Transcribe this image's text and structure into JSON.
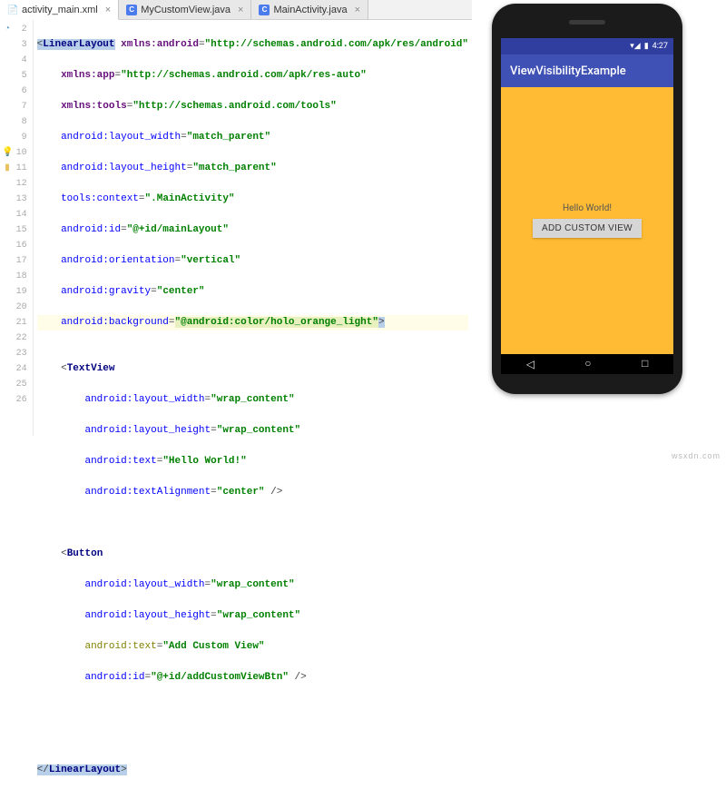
{
  "tabs": [
    {
      "label": "activity_main.xml",
      "kind": "xml",
      "active": true
    },
    {
      "label": "MyCustomView.java",
      "kind": "java",
      "active": false
    },
    {
      "label": "MainActivity.java",
      "kind": "java",
      "active": false
    }
  ],
  "gutter": {
    "lines": [
      "2",
      "3",
      "4",
      "5",
      "6",
      "7",
      "8",
      "9",
      "10",
      "11",
      "12",
      "13",
      "14",
      "15",
      "16",
      "17",
      "18",
      "19",
      "20",
      "21",
      "22",
      "23",
      "24",
      "25",
      "26"
    ],
    "bulb_at": "10",
    "warn_at": "11",
    "circle_at": "2",
    "fold_at": [
      "2",
      "13",
      "19",
      "26"
    ]
  },
  "code": {
    "l2": {
      "open": "<",
      "tag": "LinearLayout",
      "sp": " ",
      "ns": "xmlns:android",
      "eq": "=",
      "val": "\"http://schemas.android.com/apk/res/android\""
    },
    "l3": {
      "ns": "xmlns:app",
      "eq": "=",
      "val": "\"http://schemas.android.com/apk/res-auto\""
    },
    "l4": {
      "ns": "xmlns:tools",
      "eq": "=",
      "val": "\"http://schemas.android.com/tools\""
    },
    "l5": {
      "attr": "android:layout_width",
      "eq": "=",
      "val": "\"match_parent\""
    },
    "l6": {
      "attr": "android:layout_height",
      "eq": "=",
      "val": "\"match_parent\""
    },
    "l7": {
      "attr": "tools:context",
      "eq": "=",
      "val": "\".MainActivity\""
    },
    "l8": {
      "attr": "android:id",
      "eq": "=",
      "val": "\"@+id/mainLayout\""
    },
    "l9": {
      "attr": "android:orientation",
      "eq": "=",
      "val": "\"vertical\""
    },
    "l10": {
      "attr": "android:gravity",
      "eq": "=",
      "val": "\"center\""
    },
    "l11": {
      "attr": "android:background",
      "eq": "=",
      "val": "\"@android:color/holo_orange_light\"",
      "close": ">"
    },
    "l13": {
      "open": "<",
      "tag": "TextView"
    },
    "l14": {
      "attr": "android:layout_width",
      "eq": "=",
      "val": "\"wrap_content\""
    },
    "l15": {
      "attr": "android:layout_height",
      "eq": "=",
      "val": "\"wrap_content\""
    },
    "l16": {
      "attr": "android:text",
      "eq": "=",
      "val": "\"Hello World!\""
    },
    "l17": {
      "attr": "android:textAlignment",
      "eq": "=",
      "val": "\"center\"",
      "close": " />"
    },
    "l19": {
      "open": "<",
      "tag": "Button"
    },
    "l20": {
      "attr": "android:layout_width",
      "eq": "=",
      "val": "\"wrap_content\""
    },
    "l21": {
      "attr": "android:layout_height",
      "eq": "=",
      "val": "\"wrap_content\""
    },
    "l22": {
      "attr": "android:text",
      "eq": "=",
      "val": "\"Add Custom View\""
    },
    "l23": {
      "attr": "android:id",
      "eq": "=",
      "val": "\"@+id/addCustomViewBtn\"",
      "close": " />"
    },
    "l26": {
      "open": "</",
      "tag": "LinearLayout",
      "close": ">"
    }
  },
  "phone": {
    "status_time": "4:27",
    "app_title": "ViewVisibilityExample",
    "hello_text": "Hello World!",
    "button_text": "ADD CUSTOM VIEW"
  },
  "watermark": "wsxdn.com"
}
